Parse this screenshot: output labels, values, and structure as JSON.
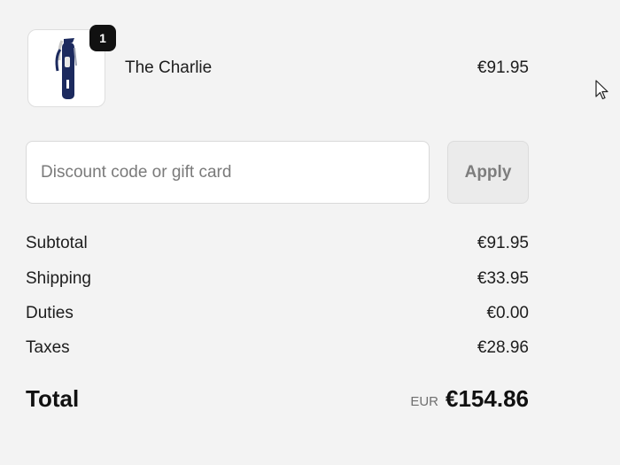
{
  "cart": {
    "items": [
      {
        "name": "The Charlie",
        "quantity": "1",
        "price": "€91.95"
      }
    ]
  },
  "discount": {
    "placeholder": "Discount code or gift card",
    "value": "",
    "apply_label": "Apply"
  },
  "summary": {
    "subtotal_label": "Subtotal",
    "subtotal_value": "€91.95",
    "shipping_label": "Shipping",
    "shipping_value": "€33.95",
    "duties_label": "Duties",
    "duties_value": "€0.00",
    "taxes_label": "Taxes",
    "taxes_value": "€28.96",
    "total_label": "Total",
    "currency": "EUR",
    "total_value": "€154.86"
  },
  "icons": {
    "product_image": "golf-bag-image",
    "cursor": "mouse-pointer-icon"
  },
  "colors": {
    "background": "#f3f3f3",
    "badge": "#111111",
    "apply_button": "#ebebeb"
  }
}
